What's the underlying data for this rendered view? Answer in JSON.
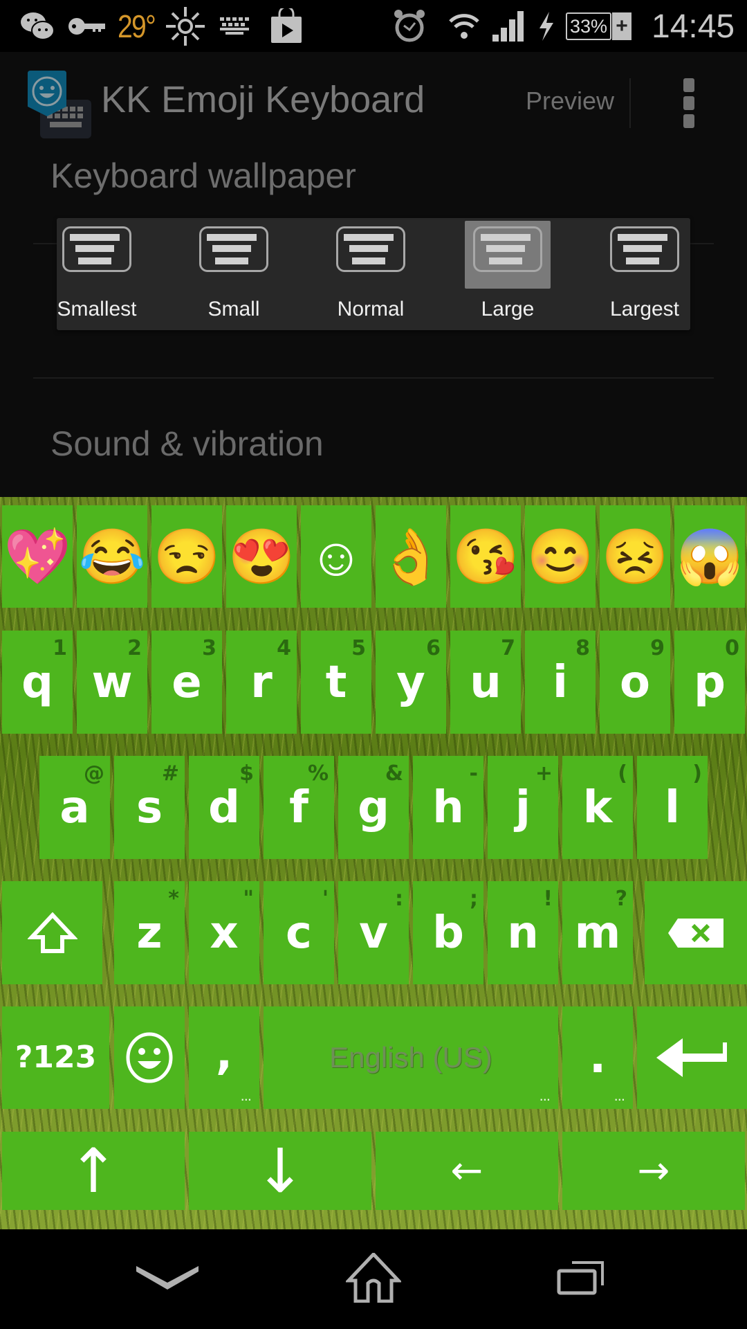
{
  "status_bar": {
    "left_icons": [
      "wechat-icon",
      "vpn-key-icon",
      "brightness-icon",
      "keyboard-icon",
      "play-store-icon"
    ],
    "temperature": "29°",
    "right_icons": [
      "alarm-icon",
      "wifi-icon",
      "signal-icon",
      "charging-icon"
    ],
    "battery": "33%",
    "battery_extra": "+",
    "time": "14:45"
  },
  "app_bar": {
    "title": "KK Emoji Keyboard",
    "preview_label": "Preview",
    "overflow_icon": "more-vert-icon",
    "accent": "#0b5a7a"
  },
  "settings": {
    "sections": [
      {
        "title": "Keyboard wallpaper"
      },
      {
        "title": "Sound & vibration"
      }
    ]
  },
  "size_popup": {
    "options": [
      {
        "label": "Smallest",
        "selected": false
      },
      {
        "label": "Small",
        "selected": false
      },
      {
        "label": "Normal",
        "selected": false
      },
      {
        "label": "Large",
        "selected": true
      },
      {
        "label": "Largest",
        "selected": false
      }
    ]
  },
  "keyboard": {
    "key_color": "#4eb61e",
    "hint_color": "#2a6a10",
    "emoji_row": [
      "💖",
      "😂",
      "😒",
      "😍",
      "☺",
      "👌",
      "😘",
      "😊",
      "😣",
      "😱"
    ],
    "row1": [
      {
        "key": "q",
        "hint": "1"
      },
      {
        "key": "w",
        "hint": "2"
      },
      {
        "key": "e",
        "hint": "3"
      },
      {
        "key": "r",
        "hint": "4"
      },
      {
        "key": "t",
        "hint": "5"
      },
      {
        "key": "y",
        "hint": "6"
      },
      {
        "key": "u",
        "hint": "7"
      },
      {
        "key": "i",
        "hint": "8"
      },
      {
        "key": "o",
        "hint": "9"
      },
      {
        "key": "p",
        "hint": "0"
      }
    ],
    "row2": [
      {
        "key": "a",
        "hint": "@"
      },
      {
        "key": "s",
        "hint": "#"
      },
      {
        "key": "d",
        "hint": "$"
      },
      {
        "key": "f",
        "hint": "%"
      },
      {
        "key": "g",
        "hint": "&"
      },
      {
        "key": "h",
        "hint": "-"
      },
      {
        "key": "j",
        "hint": "+"
      },
      {
        "key": "k",
        "hint": "("
      },
      {
        "key": "l",
        "hint": ")"
      }
    ],
    "row3": [
      {
        "key": "z",
        "hint": "*"
      },
      {
        "key": "x",
        "hint": "\""
      },
      {
        "key": "c",
        "hint": "'"
      },
      {
        "key": "v",
        "hint": ":"
      },
      {
        "key": "b",
        "hint": ";"
      },
      {
        "key": "n",
        "hint": "!"
      },
      {
        "key": "m",
        "hint": "?"
      }
    ],
    "shift_icon": "shift-icon",
    "backspace_icon": "backspace-icon",
    "symbols_label": "?123",
    "emoji_icon": "smiley-icon",
    "comma": ",",
    "space_label": "English (US)",
    "period": ".",
    "more_indicator": "...",
    "enter_icon": "enter-icon",
    "arrows": [
      "↑",
      "↓",
      "←",
      "→"
    ]
  },
  "nav_bar": {
    "buttons": [
      "back-icon",
      "home-icon",
      "recents-icon"
    ]
  }
}
